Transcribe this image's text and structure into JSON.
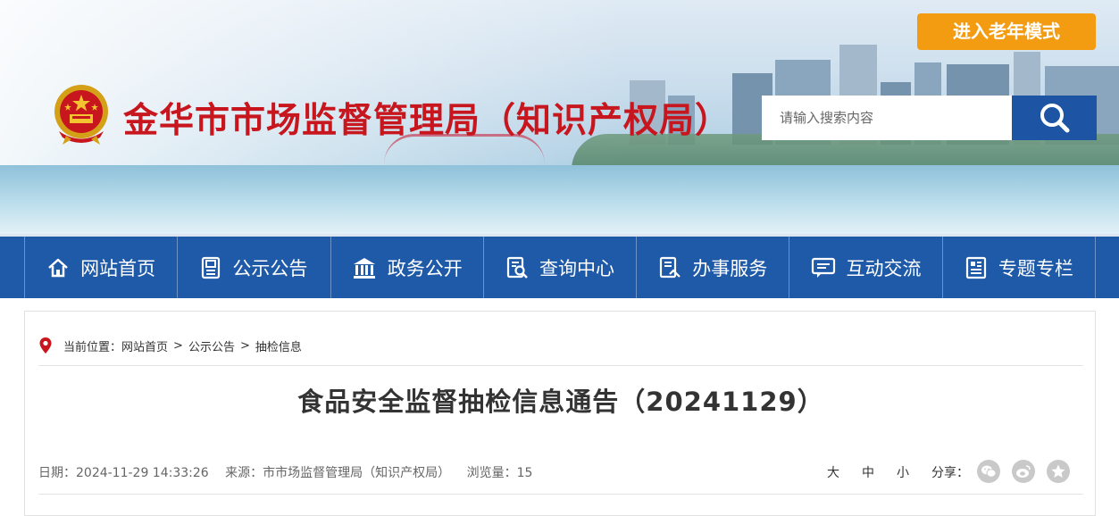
{
  "header": {
    "site_title": "金华市市场监督管理局（知识产权局）",
    "elder_mode_label": "进入老年模式",
    "search": {
      "placeholder": "请输入搜索内容"
    },
    "colors": {
      "title": "#c7161d",
      "elder_button": "#f39c12",
      "search_button": "#1d55a4"
    }
  },
  "nav": {
    "items": [
      {
        "label": "网站首页",
        "icon": "home-icon"
      },
      {
        "label": "公示公告",
        "icon": "notice-icon"
      },
      {
        "label": "政务公开",
        "icon": "government-building-icon"
      },
      {
        "label": "查询中心",
        "icon": "query-icon"
      },
      {
        "label": "办事服务",
        "icon": "service-icon"
      },
      {
        "label": "互动交流",
        "icon": "chat-icon"
      },
      {
        "label": "专题专栏",
        "icon": "column-icon"
      }
    ],
    "color": "#1f5aa8"
  },
  "breadcrumb": {
    "prefix": "当前位置：",
    "items": [
      "网站首页",
      "公示公告",
      "抽检信息"
    ],
    "separator": ">"
  },
  "article": {
    "title": "食品安全监督抽检信息通告（20241129）",
    "date": "日期：2024-11-29 14:33:26",
    "source": "来源：市市场监督管理局（知识产权局）",
    "views": "浏览量：15",
    "font_sizes": [
      "大",
      "中",
      "小"
    ],
    "share_label": "分享：",
    "share_icons": [
      "wechat-icon",
      "weibo-icon",
      "favorite-icon"
    ]
  }
}
